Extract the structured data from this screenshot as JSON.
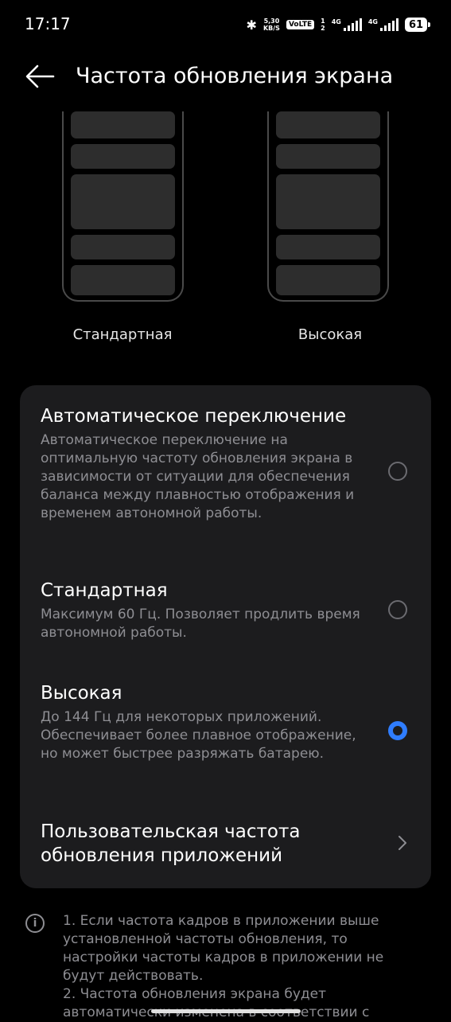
{
  "status_bar": {
    "time": "17:17",
    "speed_value": "5,30",
    "speed_unit": "KB/S",
    "volte": "VoLTE",
    "sim1_index": "1",
    "sim2_index": "2",
    "network1": "4G",
    "network2": "4G",
    "battery": "61"
  },
  "header": {
    "title": "Частота обновления экрана",
    "back_icon": "arrow-left-icon"
  },
  "previews": [
    {
      "label": "Стандартная"
    },
    {
      "label": "Высокая"
    }
  ],
  "options": [
    {
      "title": "Автоматическое переключение",
      "description": "Автоматическое переключение на оптимальную частоту обновления экрана в зависимости от ситуации для обеспечения баланса между плавностью отображения и временем автономной работы.",
      "selected": false
    },
    {
      "title": "Стандартная",
      "description": "Максимум 60 Гц. Позволяет продлить время автономной работы.",
      "selected": false
    },
    {
      "title": "Высокая",
      "description": "До 144 Гц для некоторых приложений. Обеспечивает более плавное отображение, но может быстрее разряжать батарею.",
      "selected": true
    }
  ],
  "custom_refresh": {
    "title": "Пользовательская частота обновления приложений"
  },
  "notes": {
    "line1": "1. Если частота кадров в приложении выше установленной частоты обновления, то настройки частоты кадров в приложении не будут действовать.",
    "line2": "2. Частота обновления экрана будет автоматически изменена в соответствии с"
  },
  "colors": {
    "accent": "#2f7dff",
    "card_bg": "#1c1c1e",
    "secondary_text": "#8e8e93"
  }
}
